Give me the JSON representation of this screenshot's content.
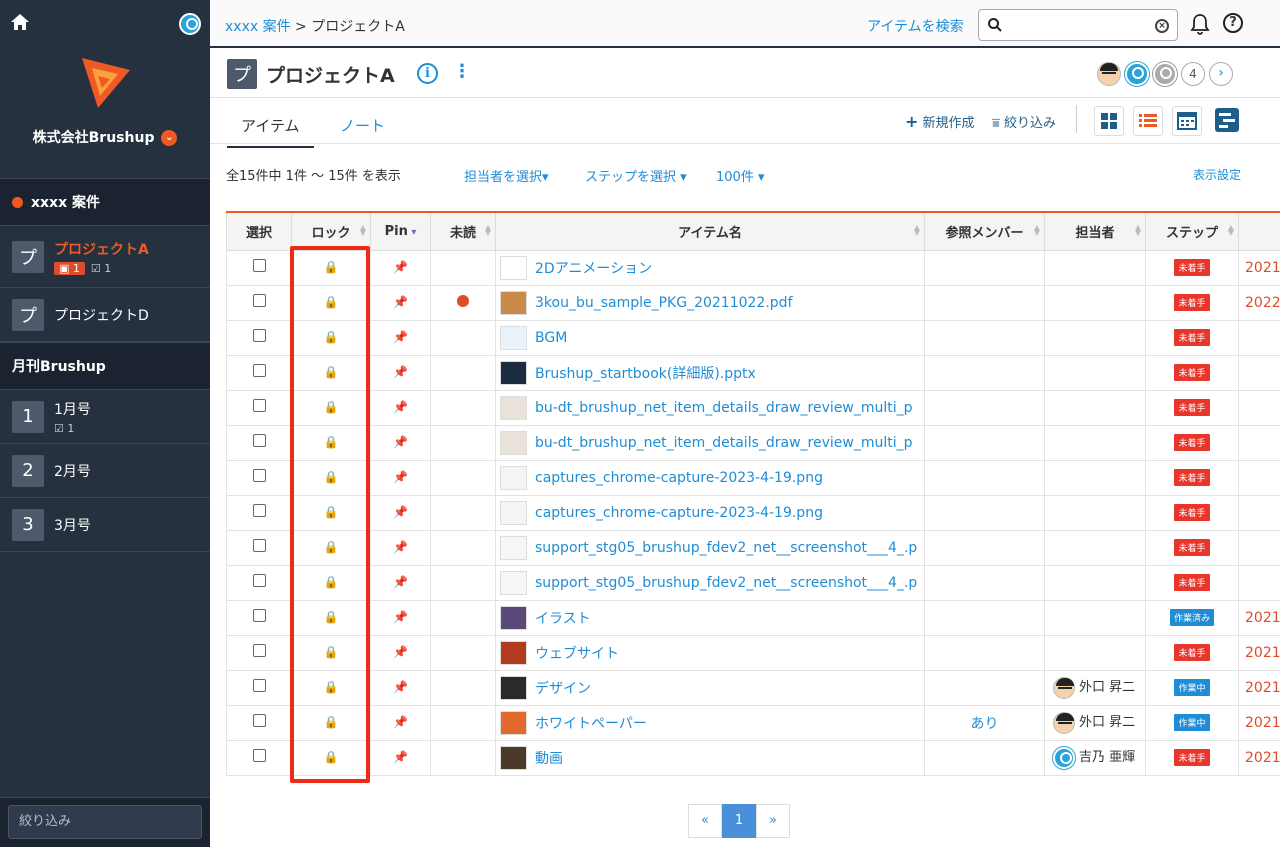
{
  "sidebar": {
    "company": "株式会社Brushup",
    "sections": [
      {
        "title": "xxxx 案件"
      },
      {
        "title": "月刊Brushup"
      }
    ],
    "projects": [
      {
        "badge": "プ",
        "label": "プロジェクトA",
        "comments": "1",
        "tasks": "1"
      },
      {
        "badge": "プ",
        "label": "プロジェクトD"
      }
    ],
    "issues": [
      {
        "badge": "1",
        "label": "1月号",
        "tasks": "1"
      },
      {
        "badge": "2",
        "label": "2月号"
      },
      {
        "badge": "3",
        "label": "3月号"
      }
    ],
    "filter_placeholder": "絞り込み"
  },
  "header": {
    "breadcrumb_link": "xxxx 案件",
    "breadcrumb_sep": " > ",
    "breadcrumb_current": "プロジェクトA",
    "search_label": "アイテムを検索",
    "help": "?"
  },
  "project": {
    "badge": "プ",
    "title": "プロジェクトA",
    "info": "i",
    "more": "⋮",
    "member_count": "4",
    "next": "›"
  },
  "tabs": {
    "items": "アイテム",
    "notes": "ノート",
    "new": "新規作成",
    "filter": "絞り込み"
  },
  "list": {
    "total": "全15件中 1件 〜 15件 を表示",
    "assignee_filter": "担当者を選択",
    "step_filter": "ステップを選択",
    "per_page": "100件",
    "display_settings": "表示設定"
  },
  "columns": [
    "選択",
    "ロック",
    "Pin",
    "未読",
    "アイテム名",
    "参照メンバー",
    "担当者",
    "ステップ"
  ],
  "rows": [
    {
      "name": "2Dアニメーション",
      "unread": false,
      "ref": "",
      "assignee": "",
      "step": "未着手",
      "stepColor": "red",
      "date": "2021",
      "thumb": "#fff"
    },
    {
      "name": "3kou_bu_sample_PKG_20211022.pdf",
      "unread": true,
      "ref": "",
      "assignee": "",
      "step": "未着手",
      "stepColor": "red",
      "date": "2022",
      "thumb": "#c98b4a"
    },
    {
      "name": "BGM",
      "unread": false,
      "ref": "",
      "assignee": "",
      "step": "未着手",
      "stepColor": "red",
      "date": "",
      "thumb": "#e8f3fb"
    },
    {
      "name": "Brushup_startbook(詳細版).pptx",
      "unread": false,
      "ref": "",
      "assignee": "",
      "step": "未着手",
      "stepColor": "red",
      "date": "",
      "thumb": "#1c2b3f"
    },
    {
      "name": "bu-dt_brushup_net_item_details_draw_review_multi_p",
      "unread": false,
      "ref": "",
      "assignee": "",
      "step": "未着手",
      "stepColor": "red",
      "date": "",
      "thumb": "#e8e2d8"
    },
    {
      "name": "bu-dt_brushup_net_item_details_draw_review_multi_p",
      "unread": false,
      "ref": "",
      "assignee": "",
      "step": "未着手",
      "stepColor": "red",
      "date": "",
      "thumb": "#e8e2d8"
    },
    {
      "name": "captures_chrome-capture-2023-4-19.png",
      "unread": false,
      "ref": "",
      "assignee": "",
      "step": "未着手",
      "stepColor": "red",
      "date": "",
      "thumb": "#f4f4f4"
    },
    {
      "name": "captures_chrome-capture-2023-4-19.png",
      "unread": false,
      "ref": "",
      "assignee": "",
      "step": "未着手",
      "stepColor": "red",
      "date": "",
      "thumb": "#f4f4f4"
    },
    {
      "name": "support_stg05_brushup_fdev2_net__screenshot___4_.p",
      "unread": false,
      "ref": "",
      "assignee": "",
      "step": "未着手",
      "stepColor": "red",
      "date": "",
      "thumb": "#f6f6f6"
    },
    {
      "name": "support_stg05_brushup_fdev2_net__screenshot___4_.p",
      "unread": false,
      "ref": "",
      "assignee": "",
      "step": "未着手",
      "stepColor": "red",
      "date": "",
      "thumb": "#f6f6f6"
    },
    {
      "name": "イラスト",
      "unread": false,
      "ref": "",
      "assignee": "",
      "step": "作業済み",
      "stepColor": "blue",
      "date": "2021",
      "thumb": "#5a4a7a"
    },
    {
      "name": "ウェブサイト",
      "unread": false,
      "ref": "",
      "assignee": "",
      "step": "未着手",
      "stepColor": "red",
      "date": "2021",
      "thumb": "#b23a1e"
    },
    {
      "name": "デザイン",
      "unread": false,
      "ref": "",
      "assignee": "外口 昇二",
      "assigneeAvatar": "face",
      "step": "作業中",
      "stepColor": "blue",
      "date": "2021",
      "thumb": "#2a2a2a"
    },
    {
      "name": "ホワイトペーパー",
      "unread": false,
      "ref": "あり",
      "assignee": "外口 昇二",
      "assigneeAvatar": "face",
      "step": "作業中",
      "stepColor": "blue",
      "date": "2021",
      "thumb": "#e26a2c"
    },
    {
      "name": "動画",
      "unread": false,
      "ref": "",
      "assignee": "吉乃 亜輝",
      "assigneeAvatar": "blue",
      "step": "未着手",
      "stepColor": "red",
      "date": "2021",
      "thumb": "#4a3a2a"
    }
  ],
  "pager": {
    "prev": "«",
    "current": "1",
    "next": "»"
  },
  "colors": {
    "accent": "#ef5a24",
    "link": "#1f8dd6",
    "sidebar": "#263140",
    "highlight": "#f02b15"
  }
}
